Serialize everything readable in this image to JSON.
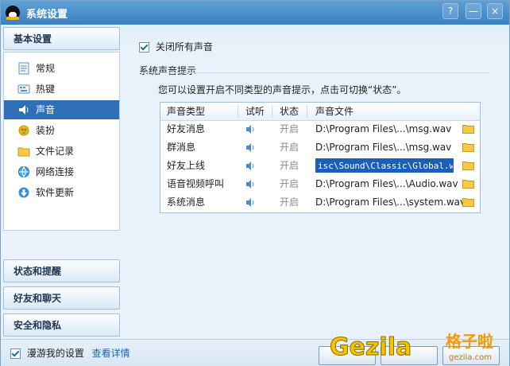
{
  "window": {
    "title": "系统设置",
    "help_label": "?",
    "min_label": "—",
    "close_label": "×"
  },
  "sidebar": {
    "sections": [
      {
        "label": "基本设置"
      },
      {
        "label": "状态和提醒"
      },
      {
        "label": "好友和聊天"
      },
      {
        "label": "安全和隐私"
      }
    ],
    "items": [
      {
        "label": "常规",
        "icon": "general-icon"
      },
      {
        "label": "热键",
        "icon": "hotkey-icon"
      },
      {
        "label": "声音",
        "icon": "speaker-icon",
        "active": true
      },
      {
        "label": "装扮",
        "icon": "skin-icon"
      },
      {
        "label": "文件记录",
        "icon": "folder-icon"
      },
      {
        "label": "网络连接",
        "icon": "network-icon"
      },
      {
        "label": "软件更新",
        "icon": "update-icon"
      }
    ]
  },
  "content": {
    "mute_all_label": "关闭所有声音",
    "mute_all_checked": true,
    "section_title": "系统声音提示",
    "hint": "您可以设置开启不同类型的声音提示，点击可切换“状态”。",
    "table": {
      "headers": [
        "声音类型",
        "试听",
        "状态",
        "声音文件"
      ],
      "rows": [
        {
          "type": "好友消息",
          "state": "开启",
          "file": "D:\\Program Files\\...\\msg.wav"
        },
        {
          "type": "群消息",
          "state": "开启",
          "file": "D:\\Program Files\\...\\msg.wav"
        },
        {
          "type": "好友上线",
          "state": "开启",
          "file": "isc\\Sound\\Classic\\Global.wav",
          "editing": true
        },
        {
          "type": "语音视频呼叫",
          "state": "开启",
          "file": "D:\\Program Files\\...\\Audio.wav"
        },
        {
          "type": "系统消息",
          "state": "开启",
          "file": "D:\\Program Files\\...\\system.wav"
        }
      ]
    }
  },
  "bottom": {
    "roam_label": "漫游我的设置",
    "roam_checked": true,
    "details_link": "查看详情"
  },
  "watermark": {
    "text": "Gezila",
    "cn": "格子啦",
    "url": "gezila.com"
  },
  "colors": {
    "accent": "#2f6fb8",
    "titlebar": "#3a7fc0"
  }
}
